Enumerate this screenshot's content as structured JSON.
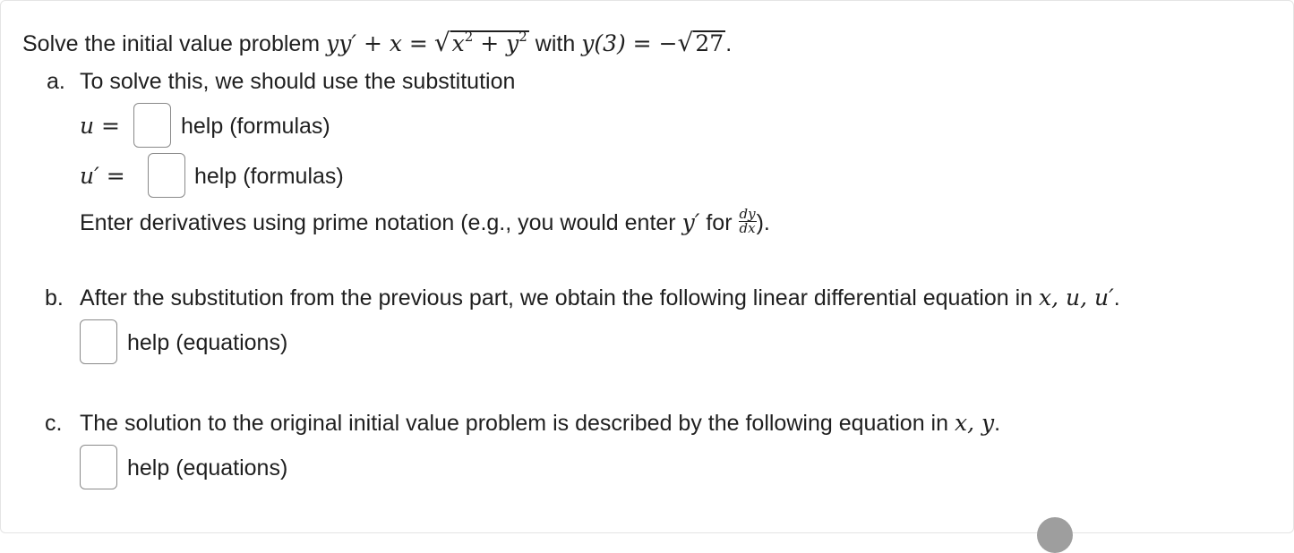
{
  "problem": {
    "prefix": "Solve the initial value problem",
    "equation_lhs": "yy′ + x =",
    "radicand_x": "x",
    "radicand_plus": " + ",
    "radicand_y": "y",
    "exponent": "2",
    "with_word": "with",
    "condition_lhs": "y(3) = −",
    "condition_radicand": "27",
    "period": "."
  },
  "part_a": {
    "letter": "a.",
    "intro": "To solve this, we should use the substitution",
    "u_label": "u =",
    "uprime_label": "u′ =",
    "u_help": "help (formulas)",
    "uprime_help": "help (formulas)",
    "instruction_prefix": "Enter derivatives using prime notation (e.g., you would enter",
    "instruction_var": "y′",
    "instruction_for": "for",
    "frac_num": "dy",
    "frac_den": "dx",
    "instruction_suffix": ")."
  },
  "part_b": {
    "letter": "b.",
    "text": "After the substitution from the previous part, we obtain the following linear differential equation in",
    "vars": "x, u, u′",
    "period": ".",
    "help": "help (equations)"
  },
  "part_c": {
    "letter": "c.",
    "text": "The solution to the original initial value problem is described by the following equation in",
    "vars": "x, y",
    "period": ".",
    "help": "help (equations)"
  }
}
